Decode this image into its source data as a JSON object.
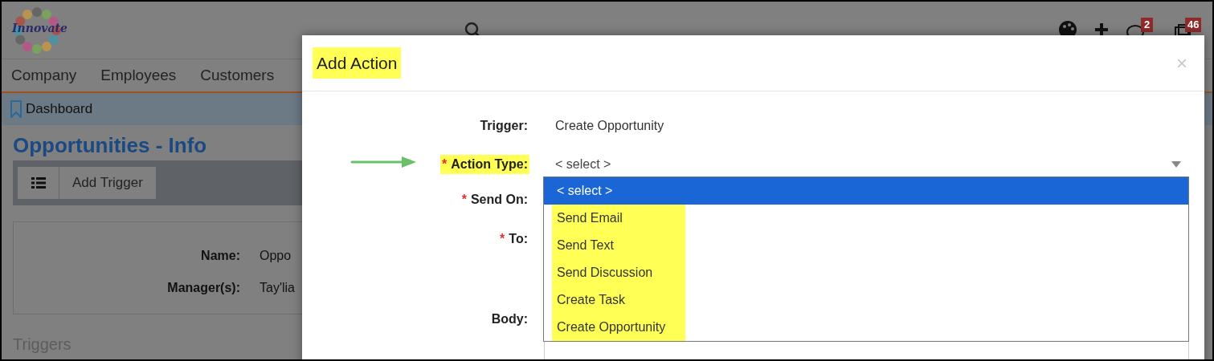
{
  "page": {
    "logo_text": "Innovate",
    "header_badges": [
      "2",
      "46"
    ],
    "nav": [
      {
        "label": "Company"
      },
      {
        "label": "Employees"
      },
      {
        "label": "Customers"
      }
    ],
    "breadcrumb": "Dashboard",
    "title": "Opportunities - Info",
    "toolbar": {
      "button": "Add Trigger"
    },
    "info": [
      {
        "label": "Name:",
        "value": "Oppo"
      },
      {
        "label": "Manager(s):",
        "value": "Tay'lia"
      }
    ],
    "section": "Triggers"
  },
  "modal": {
    "title": "Add Action",
    "close": "×",
    "required_mark": "*",
    "fields": [
      {
        "kind": "text",
        "label": "Trigger:",
        "required": false,
        "highlighted": false,
        "value": "Create Opportunity"
      },
      {
        "kind": "select",
        "label": "Action Type:",
        "required": true,
        "highlighted": true,
        "value": "< select >"
      },
      {
        "kind": "hidden",
        "label": "Send On:",
        "required": true,
        "highlighted": false
      },
      {
        "kind": "hidden",
        "label": "To:",
        "required": true,
        "highlighted": false
      },
      {
        "kind": "textarea",
        "label": "Body:",
        "required": false,
        "highlighted": false
      }
    ],
    "dropdown": [
      {
        "label": "< select >",
        "selected": true,
        "highlighted": false
      },
      {
        "label": "Send Email",
        "selected": false,
        "highlighted": true
      },
      {
        "label": "Send Text",
        "selected": false,
        "highlighted": true
      },
      {
        "label": "Send Discussion",
        "selected": false,
        "highlighted": true
      },
      {
        "label": "Create Task",
        "selected": false,
        "highlighted": true
      },
      {
        "label": "Create Opportunity",
        "selected": false,
        "highlighted": true
      }
    ]
  }
}
